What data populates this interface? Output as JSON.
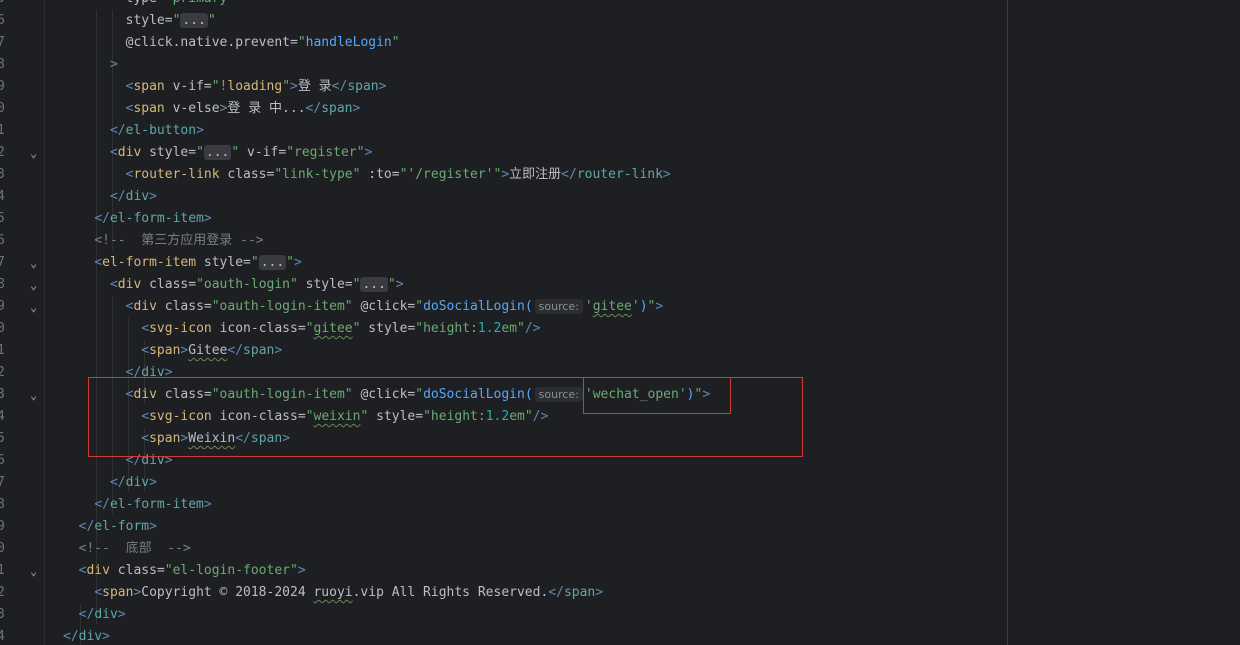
{
  "editor": {
    "lines": [
      {
        "num": "5",
        "text": "        type=\"primary\"",
        "fold": false
      },
      {
        "num": "6",
        "text": "        style=\"...\"",
        "fold": false
      },
      {
        "num": "7",
        "text": "        @click.native.prevent=\"handleLogin\"",
        "fold": false
      },
      {
        "num": "8",
        "text": "      >",
        "fold": false
      },
      {
        "num": "9",
        "text": "        <span v-if=\"!loading\">登 录</span>",
        "fold": false
      },
      {
        "num": "0",
        "text": "        <span v-else>登 录 中...</span>",
        "fold": false
      },
      {
        "num": "1",
        "text": "      </el-button>",
        "fold": false
      },
      {
        "num": "2",
        "text": "      <div style=\"...\" v-if=\"register\">",
        "fold": true
      },
      {
        "num": "3",
        "text": "        <router-link class=\"link-type\" :to=\"'/register'\">立即注册</router-link>",
        "fold": false
      },
      {
        "num": "4",
        "text": "      </div>",
        "fold": false
      },
      {
        "num": "5",
        "text": "    </el-form-item>",
        "fold": false
      },
      {
        "num": "6",
        "text": "    <!--  第三方应用登录 -->",
        "fold": false
      },
      {
        "num": "7",
        "text": "    <el-form-item style=\"...\">",
        "fold": true
      },
      {
        "num": "8",
        "text": "      <div class=\"oauth-login\" style=\"...\">",
        "fold": true
      },
      {
        "num": "9",
        "text": "        <div class=\"oauth-login-item\" @click=\"doSocialLogin( source: 'gitee')\">",
        "fold": true
      },
      {
        "num": "0",
        "text": "          <svg-icon icon-class=\"gitee\" style=\"height:1.2em\"/>",
        "fold": false
      },
      {
        "num": "1",
        "text": "          <span>Gitee</span>",
        "fold": false
      },
      {
        "num": "2",
        "text": "        </div>",
        "fold": false
      },
      {
        "num": "3",
        "text": "        <div class=\"oauth-login-item\" @click=\"doSocialLogin( source: 'wechat_open')\">",
        "fold": true
      },
      {
        "num": "4",
        "text": "          <svg-icon icon-class=\"weixin\" style=\"height:1.2em\"/>",
        "fold": false
      },
      {
        "num": "5",
        "text": "          <span>Weixin</span>",
        "fold": false
      },
      {
        "num": "6",
        "text": "        </div>",
        "fold": false
      },
      {
        "num": "7",
        "text": "      </div>",
        "fold": false
      },
      {
        "num": "8",
        "text": "    </el-form-item>",
        "fold": false
      },
      {
        "num": "9",
        "text": "  </el-form>",
        "fold": false
      },
      {
        "num": "0",
        "text": "  <!--  底部  -->",
        "fold": false
      },
      {
        "num": "1",
        "text": "  <div class=\"el-login-footer\">",
        "fold": true
      },
      {
        "num": "2",
        "text": "    <span>Copyright © 2018-2024 ruoyi.vip All Rights Reserved.</span>",
        "fold": false
      },
      {
        "num": "3",
        "text": "  </div>",
        "fold": false
      },
      {
        "num": "4",
        "text": "</div>",
        "fold": false
      }
    ],
    "colors": {
      "background": "#1e1f22",
      "tag": "#d5b778",
      "string": "#6aab73",
      "function": "#56a8f5",
      "comment": "#7a7e85",
      "annotation_box": "#d23a3a"
    },
    "icons": {
      "fold": "chevron-down-icon"
    }
  }
}
